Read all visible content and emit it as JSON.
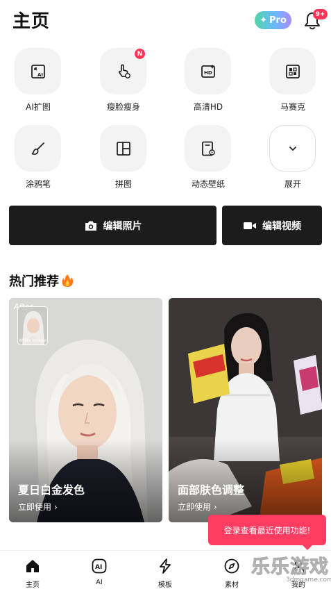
{
  "header": {
    "title": "主页",
    "pro_label": "Pro",
    "notification_count": "9+"
  },
  "tools": [
    {
      "label": "AI扩图",
      "icon": "ai-expand-icon"
    },
    {
      "label": "瘦脸瘦身",
      "icon": "hand-touch-icon",
      "badge": "N"
    },
    {
      "label": "高清HD",
      "icon": "hd-icon"
    },
    {
      "label": "马赛克",
      "icon": "mosaic-icon"
    },
    {
      "label": "涂鸦笔",
      "icon": "brush-icon"
    },
    {
      "label": "拼图",
      "icon": "collage-icon"
    },
    {
      "label": "动态壁纸",
      "icon": "live-wallpaper-icon"
    },
    {
      "label": "展开",
      "icon": "chevron-down-icon"
    }
  ],
  "actions": {
    "edit_photo": "编辑照片",
    "edit_video": "编辑视频"
  },
  "section": {
    "title": "热门推荐"
  },
  "cards": [
    {
      "title": "夏日白金发色",
      "use": "立即使用 ›",
      "after_tag": "After",
      "thumb_caption": "White blonde"
    },
    {
      "title": "面部肤色调整",
      "use": "立即使用 ›"
    }
  ],
  "toast": "登录查看最近使用功能!",
  "tabbar": [
    {
      "label": "主页",
      "icon": "home-icon"
    },
    {
      "label": "AI",
      "icon": "ai-icon"
    },
    {
      "label": "模板",
      "icon": "lightning-icon"
    },
    {
      "label": "素材",
      "icon": "compass-icon"
    },
    {
      "label": "我的",
      "icon": "profile-icon"
    }
  ],
  "watermark": {
    "text": "乐乐游戏",
    "url": "3dmgame.com"
  },
  "colors": {
    "accent": "#ff3456",
    "dark_button": "#1c1c1c",
    "tile_bg": "#f3f3f3"
  }
}
